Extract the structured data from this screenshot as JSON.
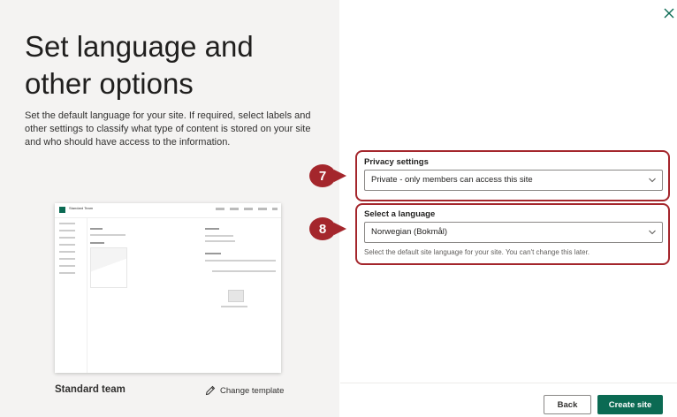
{
  "colors": {
    "accent": "#0b6a53",
    "callout": "#a4262c",
    "left_panel_bg": "#f4f3f2"
  },
  "left": {
    "title": "Set language and other options",
    "description": "Set the default language for your site. If required, select labels and other settings to classify what type of content is stored on your site and who should have access to the information.",
    "template_name": "Standard team",
    "change_template_label": "Change template",
    "change_template_icon": "pencil-icon",
    "thumbnail_site_name": "Standard Team"
  },
  "close_icon": "close-icon",
  "privacy": {
    "label": "Privacy settings",
    "value": "Private - only members can access this site",
    "callout_number": "7"
  },
  "language": {
    "label": "Select a language",
    "value": "Norwegian (Bokmål)",
    "help": "Select the default site language for your site. You can't change this later.",
    "callout_number": "8"
  },
  "footer": {
    "back_label": "Back",
    "create_label": "Create site"
  }
}
